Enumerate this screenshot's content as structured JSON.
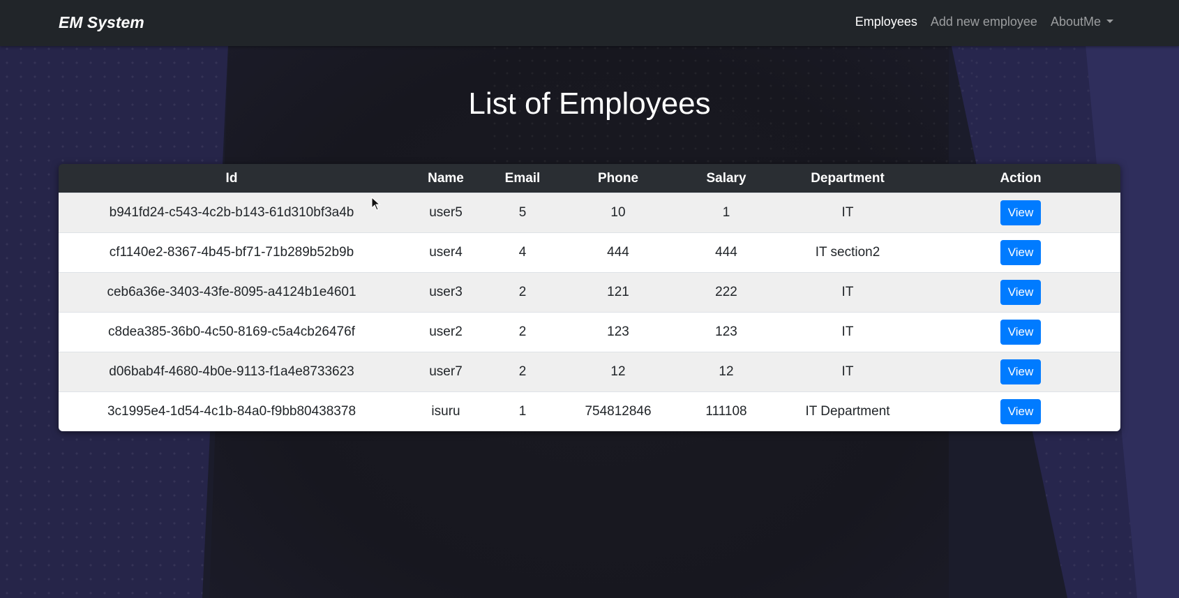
{
  "navbar": {
    "brand": "EM System",
    "links": [
      {
        "label": "Employees",
        "active": true
      },
      {
        "label": "Add new employee",
        "active": false
      },
      {
        "label": "AboutMe",
        "active": false,
        "dropdown": true
      }
    ]
  },
  "page": {
    "title": "List of Employees"
  },
  "table": {
    "columns": [
      "Id",
      "Name",
      "Email",
      "Phone",
      "Salary",
      "Department",
      "Action"
    ],
    "action_label": "View",
    "rows": [
      {
        "id": "b941fd24-c543-4c2b-b143-61d310bf3a4b",
        "name": "user5",
        "email": "5",
        "phone": "10",
        "salary": "1",
        "department": "IT"
      },
      {
        "id": "cf1140e2-8367-4b45-bf71-71b289b52b9b",
        "name": "user4",
        "email": "4",
        "phone": "444",
        "salary": "444",
        "department": "IT section2"
      },
      {
        "id": "ceb6a36e-3403-43fe-8095-a4124b1e4601",
        "name": "user3",
        "email": "2",
        "phone": "121",
        "salary": "222",
        "department": "IT"
      },
      {
        "id": "c8dea385-36b0-4c50-8169-c5a4cb26476f",
        "name": "user2",
        "email": "2",
        "phone": "123",
        "salary": "123",
        "department": "IT"
      },
      {
        "id": "d06bab4f-4680-4b0e-9113-f1a4e8733623",
        "name": "user7",
        "email": "2",
        "phone": "12",
        "salary": "12",
        "department": "IT"
      },
      {
        "id": "3c1995e4-1d54-4c1b-84a0-f9bb80438378",
        "name": "isuru",
        "email": "1",
        "phone": "754812846",
        "salary": "111108",
        "department": "IT Department"
      }
    ]
  },
  "colors": {
    "navbar_bg": "#212529",
    "table_header_bg": "#2a2e33",
    "button_primary": "#007bff",
    "page_bg": "#1b1c2b"
  }
}
